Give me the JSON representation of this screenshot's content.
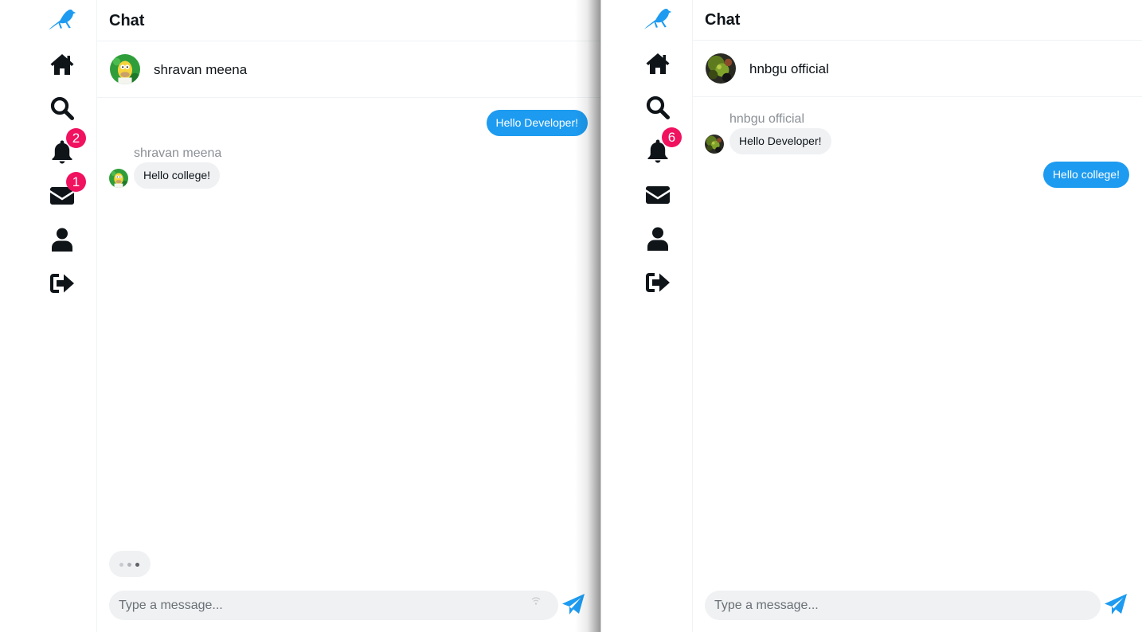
{
  "colors": {
    "accent": "#1d9bf0",
    "badge": "#f0115f",
    "text": "#0f1419",
    "muted": "#8b9096",
    "bubble_in": "#eff1f3"
  },
  "nav_icons": [
    "bird-logo-icon",
    "home-icon",
    "search-icon",
    "bell-icon",
    "envelope-icon",
    "user-icon",
    "sign-out-icon"
  ],
  "left_pane": {
    "header": {
      "title": "Chat"
    },
    "sidebar": {
      "notifications_badge": "2",
      "messages_badge": "1"
    },
    "contact": {
      "name": "shravan meena"
    },
    "messages": [
      {
        "direction": "outgoing",
        "text": "Hello Developer!"
      },
      {
        "direction": "incoming",
        "sender": "shravan meena",
        "text": "Hello college!"
      }
    ],
    "composer": {
      "placeholder": "Type a message..."
    }
  },
  "right_pane": {
    "header": {
      "title": "Chat"
    },
    "sidebar": {
      "notifications_badge": "6"
    },
    "contact": {
      "name": "hnbgu official"
    },
    "messages": [
      {
        "direction": "incoming",
        "sender": "hnbgu official",
        "text": "Hello Developer!"
      },
      {
        "direction": "outgoing",
        "text": "Hello college!"
      }
    ],
    "composer": {
      "placeholder": "Type a message..."
    }
  }
}
